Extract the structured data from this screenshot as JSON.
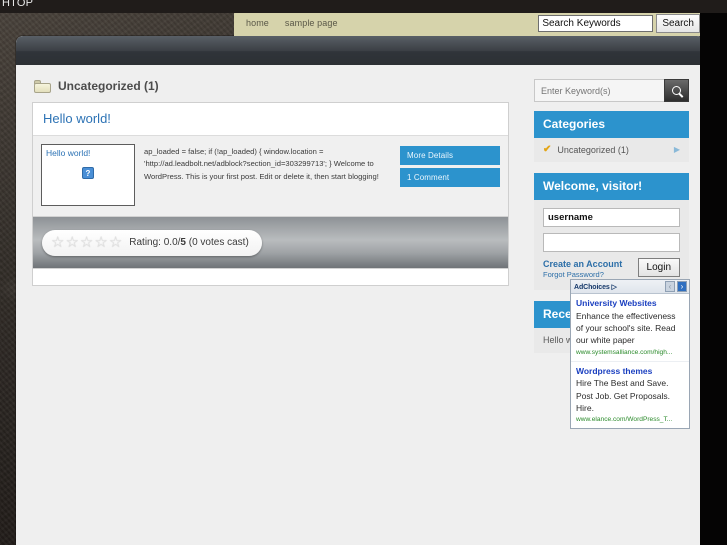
{
  "os_strip": {
    "label": "HTOP"
  },
  "header": {
    "nav": [
      {
        "label": "home"
      },
      {
        "label": "sample page"
      }
    ],
    "search": {
      "value": "Search Keywords",
      "placeholder": "Search Keywords",
      "button_label": "Search"
    }
  },
  "content": {
    "category_title": "Uncategorized (1)",
    "folder_icon": "folder-icon",
    "post": {
      "title": "Hello world!",
      "thumb_label": "Hello world!",
      "thumb_broken_glyph": "?",
      "excerpt": "ap_loaded = false; if (!ap_loaded) { window.location = 'http://ad.leadbolt.net/adblock?section_id=303299713'; } Welcome to WordPress. This is your first post. Edit or delete it, then start blogging!",
      "actions": [
        {
          "label": "More Details"
        },
        {
          "label": "1 Comment"
        }
      ],
      "rating": {
        "stars": [
          "☆",
          "☆",
          "☆",
          "☆",
          "☆"
        ],
        "prefix": "Rating: 0.0/",
        "max": "5",
        "suffix": " (0 votes cast)"
      }
    }
  },
  "sidebar": {
    "keyword_search": {
      "placeholder": "Enter Keyword(s)",
      "value": "",
      "icon": "search-icon"
    },
    "categories": {
      "heading": "Categories",
      "items": [
        {
          "check": "✔",
          "label": "Uncategorized (1)",
          "arrow": "▶"
        }
      ]
    },
    "welcome": {
      "heading": "Welcome, visitor!",
      "username_value": "username",
      "username_placeholder": "username",
      "password_value": "",
      "password_placeholder": "",
      "create_account": "Create an Account",
      "forgot_password": "Forgot Password?",
      "login_label": "Login"
    },
    "recent_posts": {
      "heading": "Recent Posts",
      "items": [
        {
          "label": "Hello world!"
        }
      ]
    }
  },
  "ad_widget": {
    "label": "AdChoices ▷",
    "prev": "‹",
    "next": "›",
    "ads": [
      {
        "title": "University Websites",
        "desc": "Enhance the effectiveness of your school's site. Read our white paper",
        "url": "www.systemsalliance.com/high..."
      },
      {
        "title": "Wordpress themes",
        "desc": "Hire The Best and Save. Post Job. Get Proposals. Hire.",
        "url": "www.elance.com/WordPress_T..."
      }
    ]
  },
  "colors": {
    "accent_blue": "#2c93cd",
    "link_blue": "#2d73b5",
    "header_khaki": "#d6d3ab",
    "panel_bg": "#efefef"
  }
}
